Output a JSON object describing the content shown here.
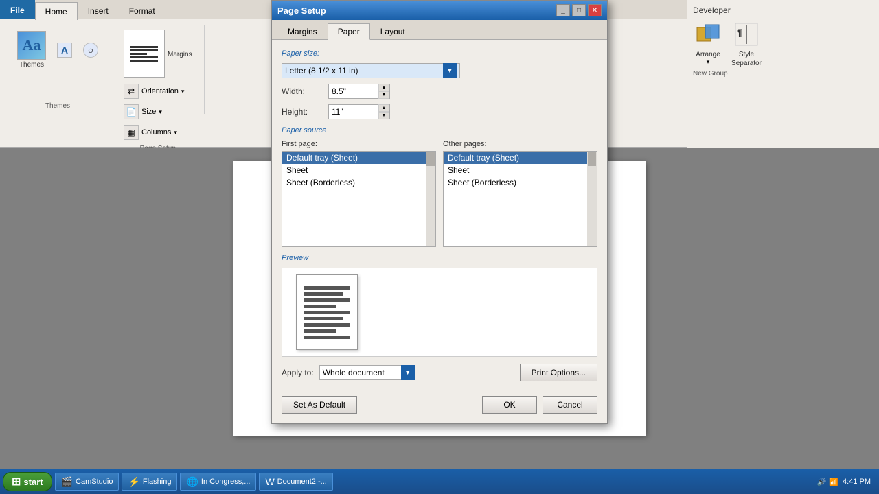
{
  "ribbon": {
    "tabs": [
      "File",
      "Home",
      "Insert",
      "Format"
    ],
    "active_tab": "Home",
    "groups": {
      "themes": {
        "label": "Themes",
        "buttons": [
          "Themes",
          "A"
        ]
      },
      "page_setup": {
        "label": "Page Setup",
        "buttons": [
          "Margins",
          "Orientation",
          "Size",
          "Columns"
        ]
      }
    }
  },
  "developer_section": {
    "label": "Developer",
    "buttons": [
      "Arrange",
      "Style Separator"
    ],
    "group_label": "New Group"
  },
  "dialog": {
    "title": "Page Setup",
    "tabs": [
      "Margins",
      "Paper",
      "Layout"
    ],
    "active_tab": "Paper",
    "paper_size": {
      "label": "Paper size:",
      "value": "Letter (8 1/2 x 11 in)",
      "dropdown_arrow": "▼"
    },
    "width": {
      "label": "Width:",
      "value": "8.5\""
    },
    "height": {
      "label": "Height:",
      "value": "11\""
    },
    "paper_source": {
      "label": "Paper source",
      "first_page": {
        "label": "First page:",
        "items": [
          "Default tray (Sheet)",
          "Sheet",
          "Sheet (Borderless)"
        ]
      },
      "other_pages": {
        "label": "Other pages:",
        "items": [
          "Default tray (Sheet)",
          "Sheet",
          "Sheet (Borderless)"
        ]
      }
    },
    "preview": {
      "label": "Preview"
    },
    "apply_to": {
      "label": "Apply to:",
      "value": "Whole document",
      "dropdown_arrow": "▼"
    },
    "buttons": {
      "print_options": "Print Options...",
      "set_as_default": "Set As Default",
      "ok": "OK",
      "cancel": "Cancel"
    }
  },
  "taskbar": {
    "start_label": "start",
    "items": [
      "CamStudio",
      "Flashing",
      "In Congress,...",
      "Document2 -..."
    ],
    "time": "4:41 PM"
  }
}
